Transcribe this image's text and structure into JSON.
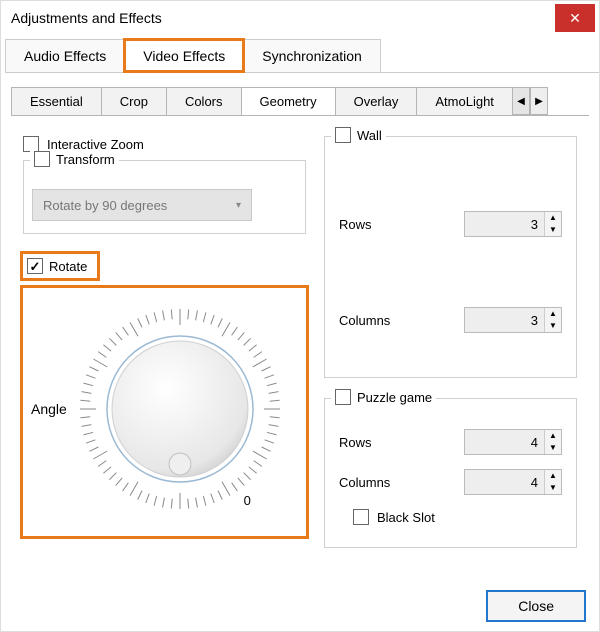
{
  "window": {
    "title": "Adjustments and Effects"
  },
  "tabs": {
    "audio": "Audio Effects",
    "video": "Video Effects",
    "sync": "Synchronization"
  },
  "subtabs": {
    "essential": "Essential",
    "crop": "Crop",
    "colors": "Colors",
    "geometry": "Geometry",
    "overlay": "Overlay",
    "atmolight": "AtmoLight"
  },
  "left": {
    "interactive_zoom": "Interactive Zoom",
    "transform": "Transform",
    "transform_option": "Rotate by 90 degrees",
    "rotate": "Rotate",
    "angle_label": "Angle",
    "angle_zero": "0"
  },
  "right": {
    "wall": "Wall",
    "rows_label": "Rows",
    "cols_label": "Columns",
    "wall_rows": "3",
    "wall_cols": "3",
    "puzzle": "Puzzle game",
    "puzzle_rows": "4",
    "puzzle_cols": "4",
    "black_slot": "Black Slot"
  },
  "footer": {
    "close": "Close"
  }
}
